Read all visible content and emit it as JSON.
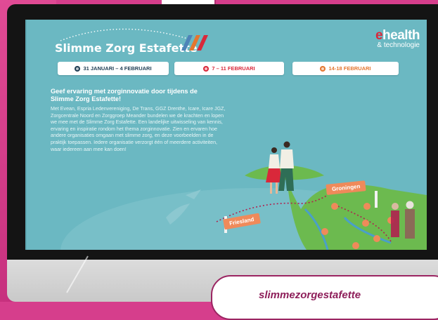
{
  "page": {
    "title": "Slimme Zorg Estafette",
    "logo": {
      "mark": "e",
      "word": "health",
      "subtitle": "& technologie"
    },
    "dates": [
      {
        "label": "31 JANUARI – 4 FEBRUARI",
        "color": "#1f3d54"
      },
      {
        "label": "7 – 11 FEBRUARI",
        "color": "#d9283a"
      },
      {
        "label": "14-18 FEBRUARI",
        "color": "#e4762f"
      }
    ],
    "heading": "Geef ervaring met zorginnovatie door tijdens de Slimme Zorg Estafette!",
    "body": "Met Evean, Espria Ledenvereniging, De Trans, GGZ Drenthe, Icare, Icare JGZ, Zorgcentrale Noord en Zorggroep Meander bundelen we de krachten en lopen we mee met de Slimme Zorg Estafette. Een landelijke uitwisseling van kennis, ervaring en inspiratie rondom het thema zorginnovatie. Zien en ervaren hoe andere organisaties omgaan met slimme zorg, en deze voorbeelden in de praktijk toepassen. Iedere organisatie verzorgt één of meerdere activiteiten, waar iedereen aan mee kan doen!",
    "map_labels": {
      "friesland": "Friesland",
      "groningen": "Groningen"
    }
  },
  "footer": {
    "url": "slimmezorgestafette"
  },
  "colors": {
    "background": "#6bb8c2",
    "pink": "#d63e8c",
    "land": "#6cba4f",
    "orange": "#ef8a5a"
  }
}
